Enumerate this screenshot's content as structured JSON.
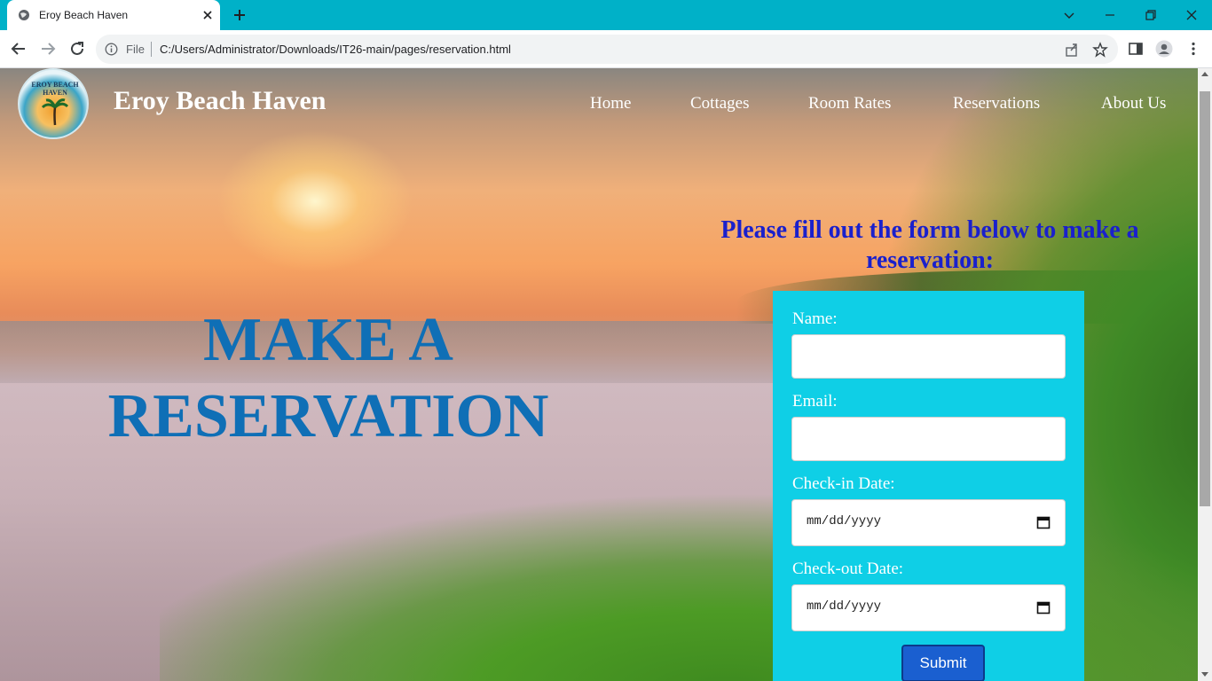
{
  "browser": {
    "tab_title": "Eroy Beach Haven",
    "address_scheme_label": "File",
    "url": "C:/Users/Administrator/Downloads/IT26-main/pages/reservation.html",
    "tabbar_color": "#00b1c8"
  },
  "site": {
    "logo_text": "EROY BEACH HAVEN",
    "brand": "Eroy Beach Haven",
    "nav": [
      "Home",
      "Cottages",
      "Room Rates",
      "Reservations",
      "About Us"
    ]
  },
  "hero": {
    "title_line1": "MAKE A",
    "title_line2": "RESERVATION",
    "title_color": "#0f6fb6"
  },
  "form": {
    "instructions": "Please fill out the form below to make a reservation:",
    "panel_color": "#0fcfe6",
    "name_label": "Name:",
    "name_value": "",
    "email_label": "Email:",
    "email_value": "",
    "checkin_label": "Check-in Date:",
    "checkin_value": "mm/dd/yyyy",
    "checkout_label": "Check-out Date:",
    "checkout_value": "mm/dd/yyyy",
    "submit_label": "Submit"
  }
}
